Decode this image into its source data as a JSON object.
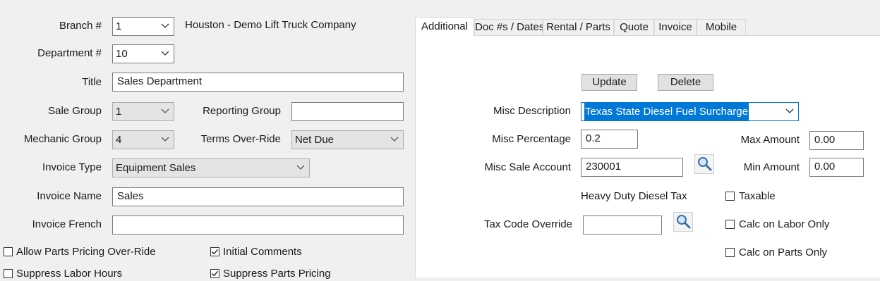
{
  "left": {
    "branch_label": "Branch #",
    "branch_value": "1",
    "branch_name": "Houston - Demo Lift Truck Company",
    "department_label": "Department #",
    "department_value": "10",
    "title_label": "Title",
    "title_value": "Sales Department",
    "sale_group_label": "Sale Group",
    "sale_group_value": "1",
    "reporting_group_label": "Reporting Group",
    "reporting_group_value": "",
    "mechanic_group_label": "Mechanic Group",
    "mechanic_group_value": "4",
    "terms_label": "Terms Over-Ride",
    "terms_value": "Net Due",
    "invoice_type_label": "Invoice Type",
    "invoice_type_value": "Equipment Sales",
    "invoice_name_label": "Invoice Name",
    "invoice_name_value": "Sales",
    "invoice_french_label": "Invoice French",
    "invoice_french_value": "",
    "allow_parts_pricing_label": "Allow Parts Pricing Over-Ride",
    "allow_parts_pricing_checked": false,
    "initial_comments_label": "Initial Comments",
    "initial_comments_checked": true,
    "suppress_labor_label": "Suppress Labor Hours",
    "suppress_labor_checked": false,
    "suppress_parts_label": "Suppress Parts Pricing",
    "suppress_parts_checked": true
  },
  "tabs": [
    {
      "label": "Additional",
      "active": true
    },
    {
      "label": "Doc #s / Dates",
      "active": false
    },
    {
      "label": "Rental / Parts",
      "active": false
    },
    {
      "label": "Quote",
      "active": false
    },
    {
      "label": "Invoice",
      "active": false
    },
    {
      "label": "Mobile",
      "active": false
    }
  ],
  "additional": {
    "update_label": "Update",
    "delete_label": "Delete",
    "misc_description_label": "Misc Description",
    "misc_description_value": "Texas State Diesel Fuel Surcharge",
    "misc_percentage_label": "Misc Percentage",
    "misc_percentage_value": "0.2",
    "max_amount_label": "Max Amount",
    "max_amount_value": "0.00",
    "misc_sale_account_label": "Misc Sale Account",
    "misc_sale_account_value": "230001",
    "min_amount_label": "Min Amount",
    "min_amount_value": "0.00",
    "account_description": "Heavy Duty Diesel Tax",
    "taxable_label": "Taxable",
    "taxable_checked": false,
    "tax_code_override_label": "Tax Code Override",
    "tax_code_override_value": "",
    "calc_labor_only_label": "Calc on Labor Only",
    "calc_labor_only_checked": false,
    "calc_parts_only_label": "Calc on Parts Only",
    "calc_parts_only_checked": false
  },
  "colors": {
    "window_bg": "#f0f0f0",
    "panel_bg": "#ffffff",
    "selection": "#0078d7",
    "focus_border": "#0078d7"
  }
}
